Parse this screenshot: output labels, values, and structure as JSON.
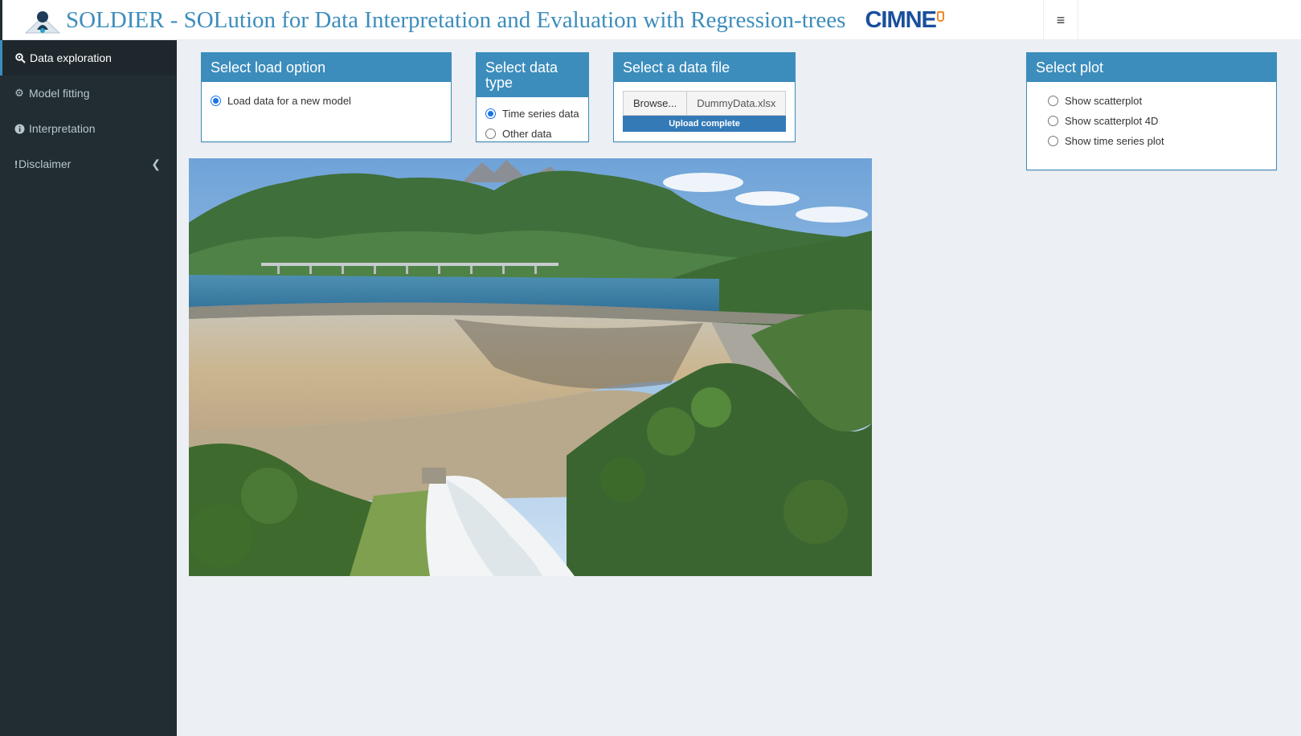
{
  "header": {
    "title": "SOLDIER - SOLution for Data Interpretation and Evaluation with Regression-trees",
    "partner_logo_text": "CIMNE",
    "logo_icon": "globe-figure-icon",
    "toggle_icon": "hamburger-icon"
  },
  "sidebar": {
    "items": [
      {
        "label": "Data exploration",
        "icon": "search-icon",
        "active": true
      },
      {
        "label": "Model fitting",
        "icon": "gear-icon",
        "active": false
      },
      {
        "label": "Interpretation",
        "icon": "info-icon",
        "active": false
      },
      {
        "label": "Disclaimer",
        "icon": "exclamation-icon",
        "active": false
      }
    ],
    "collapse_icon": "chevron-left-icon"
  },
  "load_option": {
    "title": "Select load option",
    "options": [
      {
        "label": "Load data for a new model",
        "checked": true
      }
    ]
  },
  "data_type": {
    "title": "Select data type",
    "options": [
      {
        "label": "Time series data",
        "checked": true
      },
      {
        "label": "Other data",
        "checked": false
      }
    ]
  },
  "data_file": {
    "title": "Select a data file",
    "browse_label": "Browse...",
    "file_name": "DummyData.xlsx",
    "progress_label": "Upload complete",
    "progress": 1.0
  },
  "plot": {
    "title": "Select plot",
    "options": [
      {
        "label": "Show scatterplot",
        "checked": false
      },
      {
        "label": "Show scatterplot 4D",
        "checked": false
      },
      {
        "label": "Show time series plot",
        "checked": false
      }
    ]
  },
  "colors": {
    "primary": "#3c8dbc",
    "sidebar_bg": "#222d32",
    "content_bg": "#ecf0f5",
    "cimne_blue": "#1a4f9c",
    "cimne_orange": "#f08a24"
  }
}
